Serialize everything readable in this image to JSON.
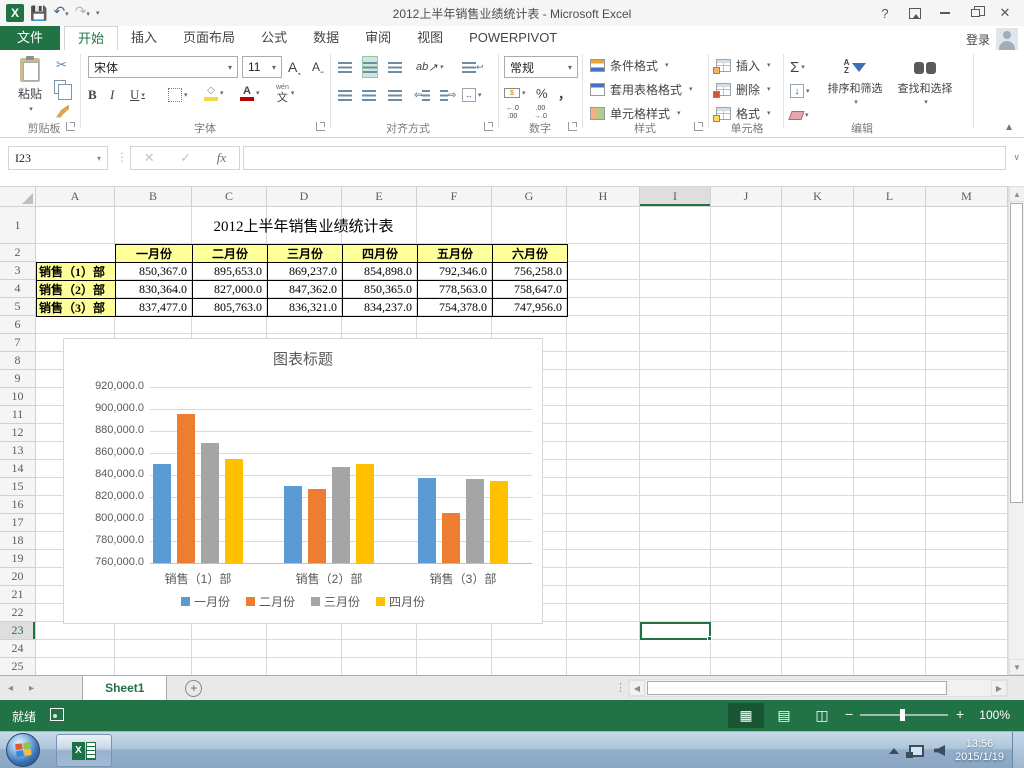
{
  "titlebar": {
    "title": "2012上半年销售业绩统计表 - Microsoft Excel",
    "help": "?",
    "signin": "登录"
  },
  "ribbon": {
    "tabs": [
      {
        "label": "文件",
        "type": "file"
      },
      {
        "label": "开始",
        "active": true
      },
      {
        "label": "插入"
      },
      {
        "label": "页面布局"
      },
      {
        "label": "公式"
      },
      {
        "label": "数据"
      },
      {
        "label": "审阅"
      },
      {
        "label": "视图"
      },
      {
        "label": "POWERPIVOT"
      }
    ],
    "clipboard": {
      "label": "剪贴板",
      "paste": "粘贴"
    },
    "font": {
      "label": "字体",
      "name": "宋体",
      "size": "11",
      "bold": "B",
      "italic": "I",
      "underline": "U",
      "phonetic": "文"
    },
    "alignment": {
      "label": "对齐方式",
      "orientation": "ab"
    },
    "number": {
      "label": "数字",
      "format": "常规",
      "percent": "%",
      "comma": "，",
      "decimals": [
        "←.0\n.00",
        ".00\n→.0"
      ]
    },
    "styles": {
      "label": "样式",
      "buttons": [
        "条件格式",
        "套用表格格式",
        "单元格样式"
      ]
    },
    "cells": {
      "label": "单元格",
      "buttons": [
        "插入",
        "删除",
        "格式"
      ]
    },
    "editing": {
      "label": "编辑",
      "sigma": "Σ",
      "buttons": [
        "排序和筛选",
        "查找和选择"
      ]
    }
  },
  "formula_bar": {
    "name_box": "I23",
    "fx": "fx",
    "value": ""
  },
  "grid": {
    "columns": [
      "A",
      "B",
      "C",
      "D",
      "E",
      "F",
      "G",
      "H",
      "I",
      "J",
      "K",
      "L",
      "M"
    ],
    "row_count": 25,
    "selected_cell": "I23",
    "selected_column": "I",
    "selected_row": 23,
    "table": {
      "title": "2012上半年销售业绩统计表",
      "months": [
        "一月份",
        "二月份",
        "三月份",
        "四月份",
        "五月份",
        "六月份"
      ],
      "rows": [
        {
          "label": "销售（1）部",
          "values": [
            "850,367.0",
            "895,653.0",
            "869,237.0",
            "854,898.0",
            "792,346.0",
            "756,258.0"
          ]
        },
        {
          "label": "销售（2）部",
          "values": [
            "830,364.0",
            "827,000.0",
            "847,362.0",
            "850,365.0",
            "778,563.0",
            "758,647.0"
          ]
        },
        {
          "label": "销售（3）部",
          "values": [
            "837,477.0",
            "805,763.0",
            "836,321.0",
            "834,237.0",
            "754,378.0",
            "747,956.0"
          ]
        }
      ]
    }
  },
  "chart_data": {
    "type": "bar",
    "title": "图表标题",
    "categories": [
      "销售（1）部",
      "销售（2）部",
      "销售（3）部"
    ],
    "series": [
      {
        "name": "一月份",
        "color": "#5B9BD5",
        "values": [
          850367,
          830364,
          837477
        ]
      },
      {
        "name": "二月份",
        "color": "#ED7D31",
        "values": [
          895653,
          827000,
          805763
        ]
      },
      {
        "name": "三月份",
        "color": "#A5A5A5",
        "values": [
          869237,
          847362,
          836321
        ]
      },
      {
        "name": "四月份",
        "color": "#FFC000",
        "values": [
          854898,
          850365,
          834237
        ]
      }
    ],
    "ylim": [
      760000,
      920000
    ],
    "ytick_step": 20000,
    "ytick_labels": [
      "920,000.0",
      "900,000.0",
      "880,000.0",
      "860,000.0",
      "840,000.0",
      "820,000.0",
      "800,000.0",
      "780,000.0",
      "760,000.0"
    ],
    "legend_position": "bottom",
    "gridlines": true
  },
  "sheet_bar": {
    "tabs": [
      {
        "label": "Sheet1",
        "active": true
      }
    ]
  },
  "status_bar": {
    "mode": "就绪",
    "zoom": "100%"
  },
  "taskbar": {
    "time": "13:56",
    "date": "2015/1/19"
  }
}
